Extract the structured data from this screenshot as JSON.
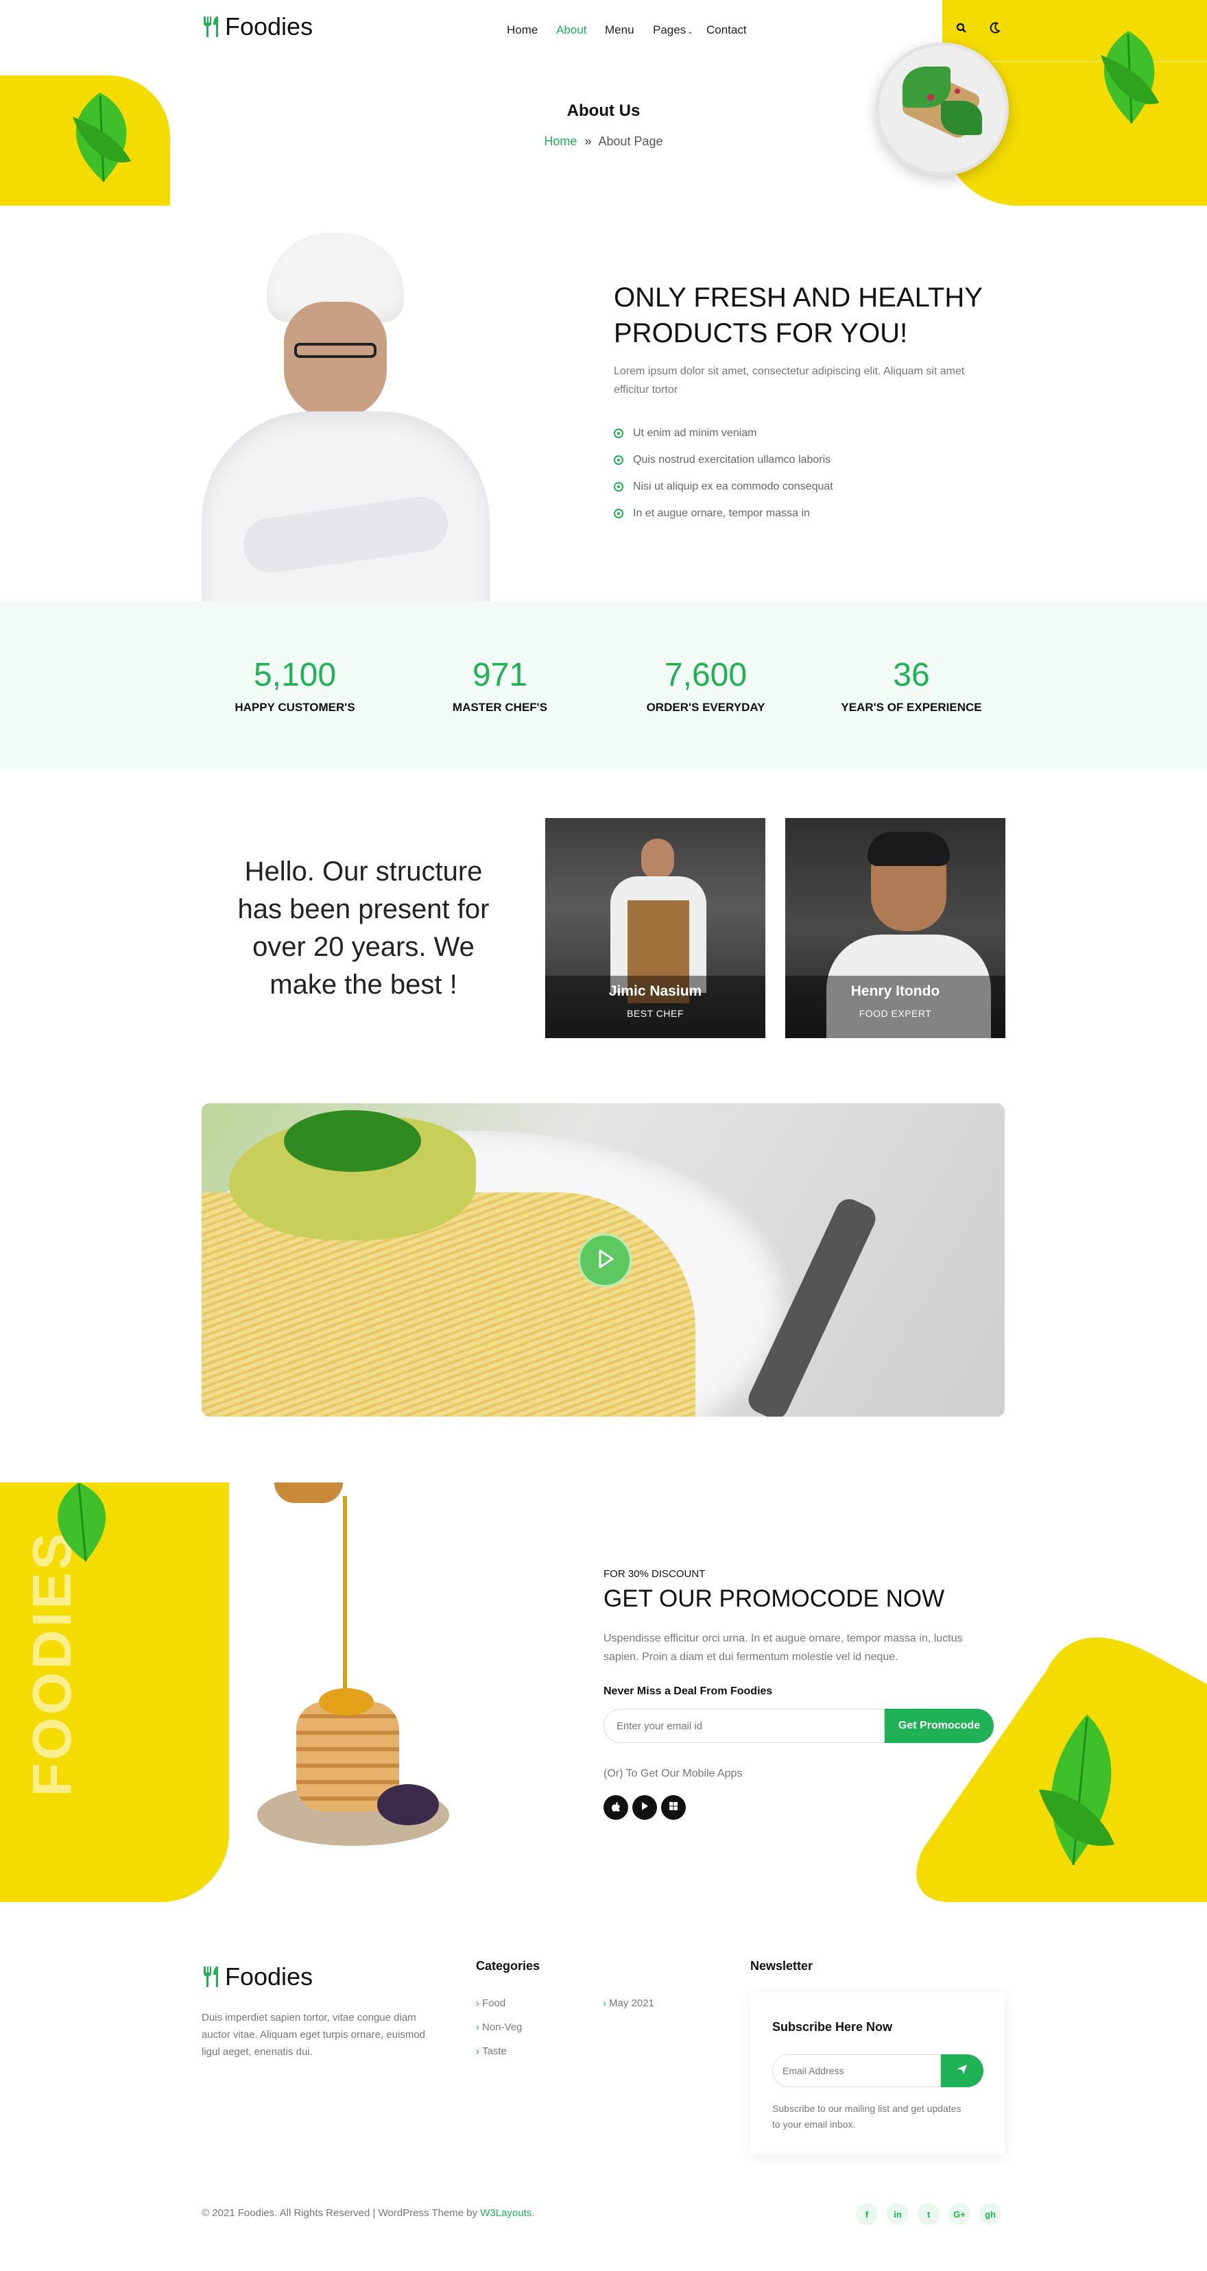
{
  "header": {
    "logo_text": "Foodies",
    "nav": [
      "Home",
      "About",
      "Menu",
      "Pages",
      "Contact"
    ],
    "active_nav": "About"
  },
  "hero": {
    "title": "About Us",
    "breadcrumb_home": "Home",
    "breadcrumb_sep": "»",
    "breadcrumb_current": "About Page"
  },
  "about": {
    "heading": "ONLY FRESH AND HEALTHY PRODUCTS FOR YOU!",
    "paragraph": "Lorem ipsum dolor sit amet, consectetur adipiscing elit. Aliquam sit amet efficitur tortor",
    "list": [
      "Ut enim ad minim veniam",
      "Quis nostrud exercitation ullamco laboris",
      "Nisi ut aliquip ex ea commodo consequat",
      "In et augue ornare, tempor massa in"
    ]
  },
  "stats": [
    {
      "num": "5,100",
      "label": "HAPPY CUSTOMER'S"
    },
    {
      "num": "971",
      "label": "MASTER CHEF'S"
    },
    {
      "num": "7,600",
      "label": "ORDER'S EVERYDAY"
    },
    {
      "num": "36",
      "label": "YEAR'S OF EXPERIENCE"
    }
  ],
  "team": {
    "intro": "Hello. Our structure has been present for over 20 years. We make the best !",
    "members": [
      {
        "name": "Jimic Nasium",
        "role": "BEST CHEF"
      },
      {
        "name": "Henry Itondo",
        "role": "FOOD EXPERT"
      }
    ]
  },
  "promo": {
    "vertical_text": "FOODIES",
    "small": "FOR 30% DISCOUNT",
    "heading": "GET OUR PROMOCODE NOW",
    "paragraph": "Uspendisse efficitur orci urna. In et augue ornare, tempor massa in, luctus sapien. Proin a diam et dui fermentum molestie vel id neque.",
    "deal_label": "Never Miss a Deal From Foodies",
    "email_placeholder": "Enter your email id",
    "button": "Get Promocode",
    "apps_label": "(Or) To Get Our Mobile Apps"
  },
  "footer": {
    "logo_text": "Foodies",
    "description": "Duis imperdiet sapien tortor, vitae congue diam auctor vitae. Aliquam eget turpis ornare, euismod ligul aeget, enenatis dui.",
    "categories_title": "Categories",
    "categories": [
      "Food",
      "Non-Veg",
      "Taste",
      "May 2021"
    ],
    "newsletter_title": "Newsletter",
    "subscribe_title": "Subscribe Here Now",
    "email_placeholder": "Email Address",
    "subscribe_note": "Subscribe to our mailing list and get updates to your email inbox.",
    "copyright": "© 2021 Foodies. All Rights Reserved | WordPress Theme by",
    "credit": "W3Layouts.",
    "social": [
      "f",
      "in",
      "t",
      "G+",
      "gh"
    ]
  },
  "colors": {
    "accent": "#1fb155",
    "yellow": "#f4dc00",
    "stats_bg": "#f2fbf6"
  }
}
